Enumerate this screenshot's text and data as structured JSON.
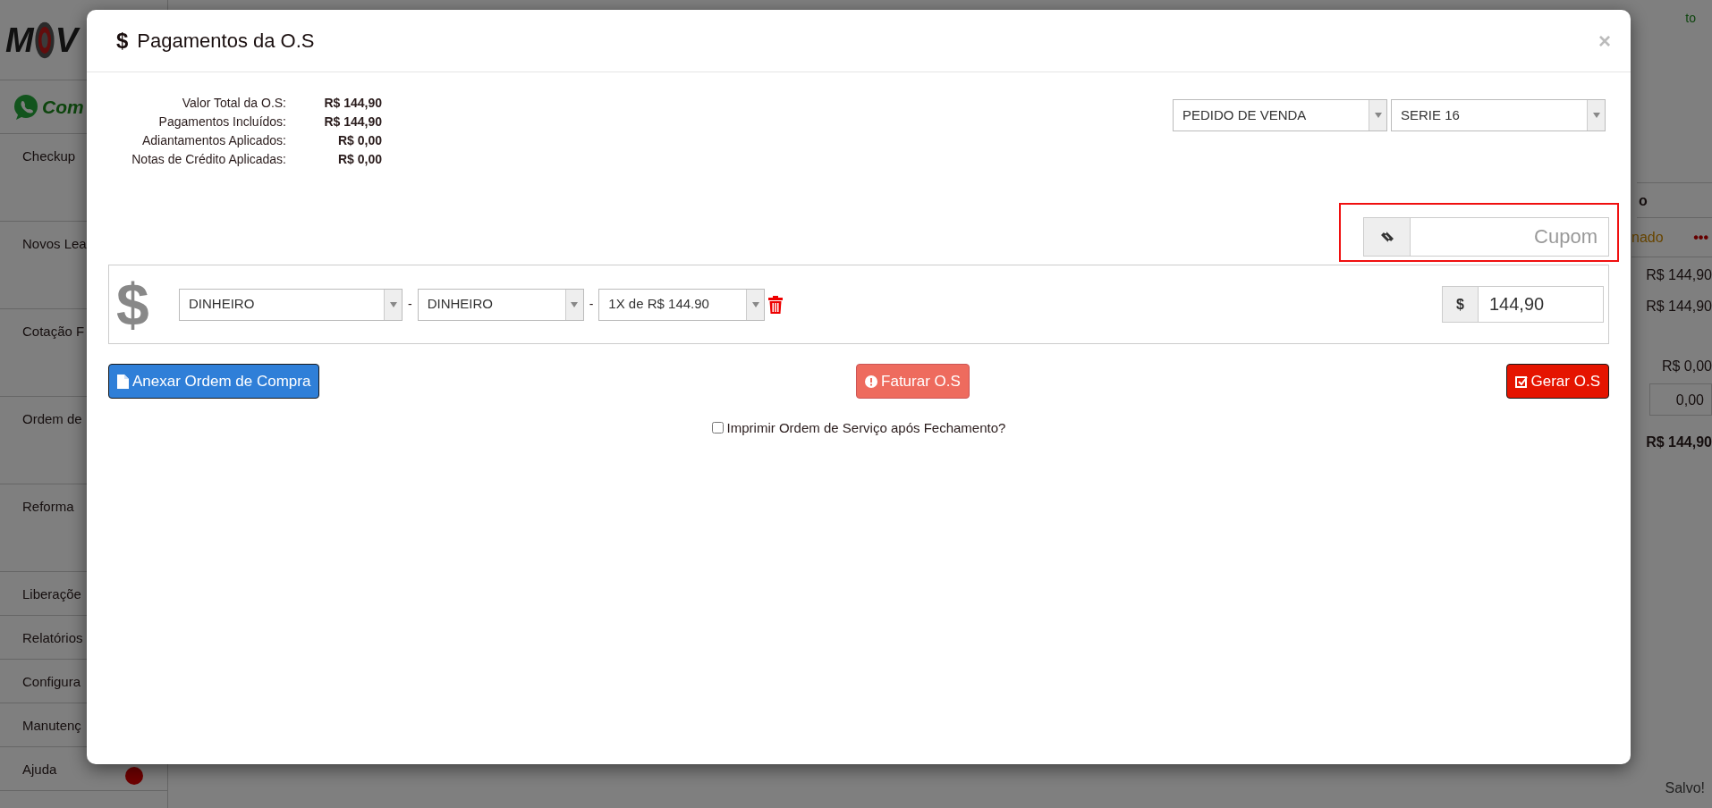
{
  "background": {
    "logo": {
      "left": "M",
      "right": "V"
    },
    "whatsapp_label": "Com",
    "sidebar": [
      {
        "label": "Checkup",
        "kind": "tall"
      },
      {
        "label": "Novos Lea",
        "kind": "tall"
      },
      {
        "label": "Cotação F",
        "kind": "tall"
      },
      {
        "label": "Ordem de",
        "kind": "tall"
      },
      {
        "label": "Reforma",
        "kind": "tall"
      },
      {
        "label": "Liberaçõe",
        "kind": "short"
      },
      {
        "label": "Relatórios",
        "kind": "short"
      },
      {
        "label": "Configura",
        "kind": "short"
      },
      {
        "label": "Manutenç",
        "kind": "short"
      },
      {
        "label": "Ajuda",
        "kind": "short",
        "badge": true
      }
    ],
    "fragments": [
      {
        "kind": "status-ok",
        "text": "to"
      },
      {
        "kind": "header",
        "text": "o"
      },
      {
        "kind": "status-row",
        "text": "nado",
        "menu": "•••"
      },
      {
        "kind": "amount",
        "text": "R$ 144,90"
      },
      {
        "kind": "amount",
        "text": "R$ 144,90"
      },
      {
        "kind": "amount-gap",
        "text": "R$ 0,00"
      },
      {
        "kind": "input",
        "text": "0,00"
      },
      {
        "kind": "total",
        "text": "R$ 144,90"
      }
    ],
    "status_text": "Salvo!"
  },
  "modal": {
    "title_icon": "$",
    "title": "Pagamentos da O.S",
    "close": "×",
    "totals": [
      {
        "label": "Valor Total da O.S:",
        "value": "R$ 144,90"
      },
      {
        "label": "Pagamentos Incluídos:",
        "value": "R$ 144,90"
      },
      {
        "label": "Adiantamentos Aplicados:",
        "value": "R$ 0,00"
      },
      {
        "label": "Notas de Crédito Aplicadas:",
        "value": "R$ 0,00"
      }
    ],
    "document_type": "PEDIDO DE VENDA",
    "series": "SERIE 16",
    "coupon": {
      "placeholder": "Cupom",
      "highlighted": true
    },
    "payments": [
      {
        "icon": "$",
        "method": "DINHEIRO",
        "separator_1": "-",
        "type": "DINHEIRO",
        "separator_2": "-",
        "installments": "1X de R$ 144.90",
        "currency": "$",
        "amount": "144,90"
      }
    ],
    "buttons": [
      {
        "kind": "attach",
        "label": "Anexar Ordem de Compra"
      },
      {
        "kind": "invoice",
        "label": "Faturar O.S"
      },
      {
        "kind": "generate",
        "label": "Gerar O.S"
      }
    ],
    "print_option": {
      "label": "Imprimir Ordem de Serviço após Fechamento?",
      "checked": false
    }
  }
}
